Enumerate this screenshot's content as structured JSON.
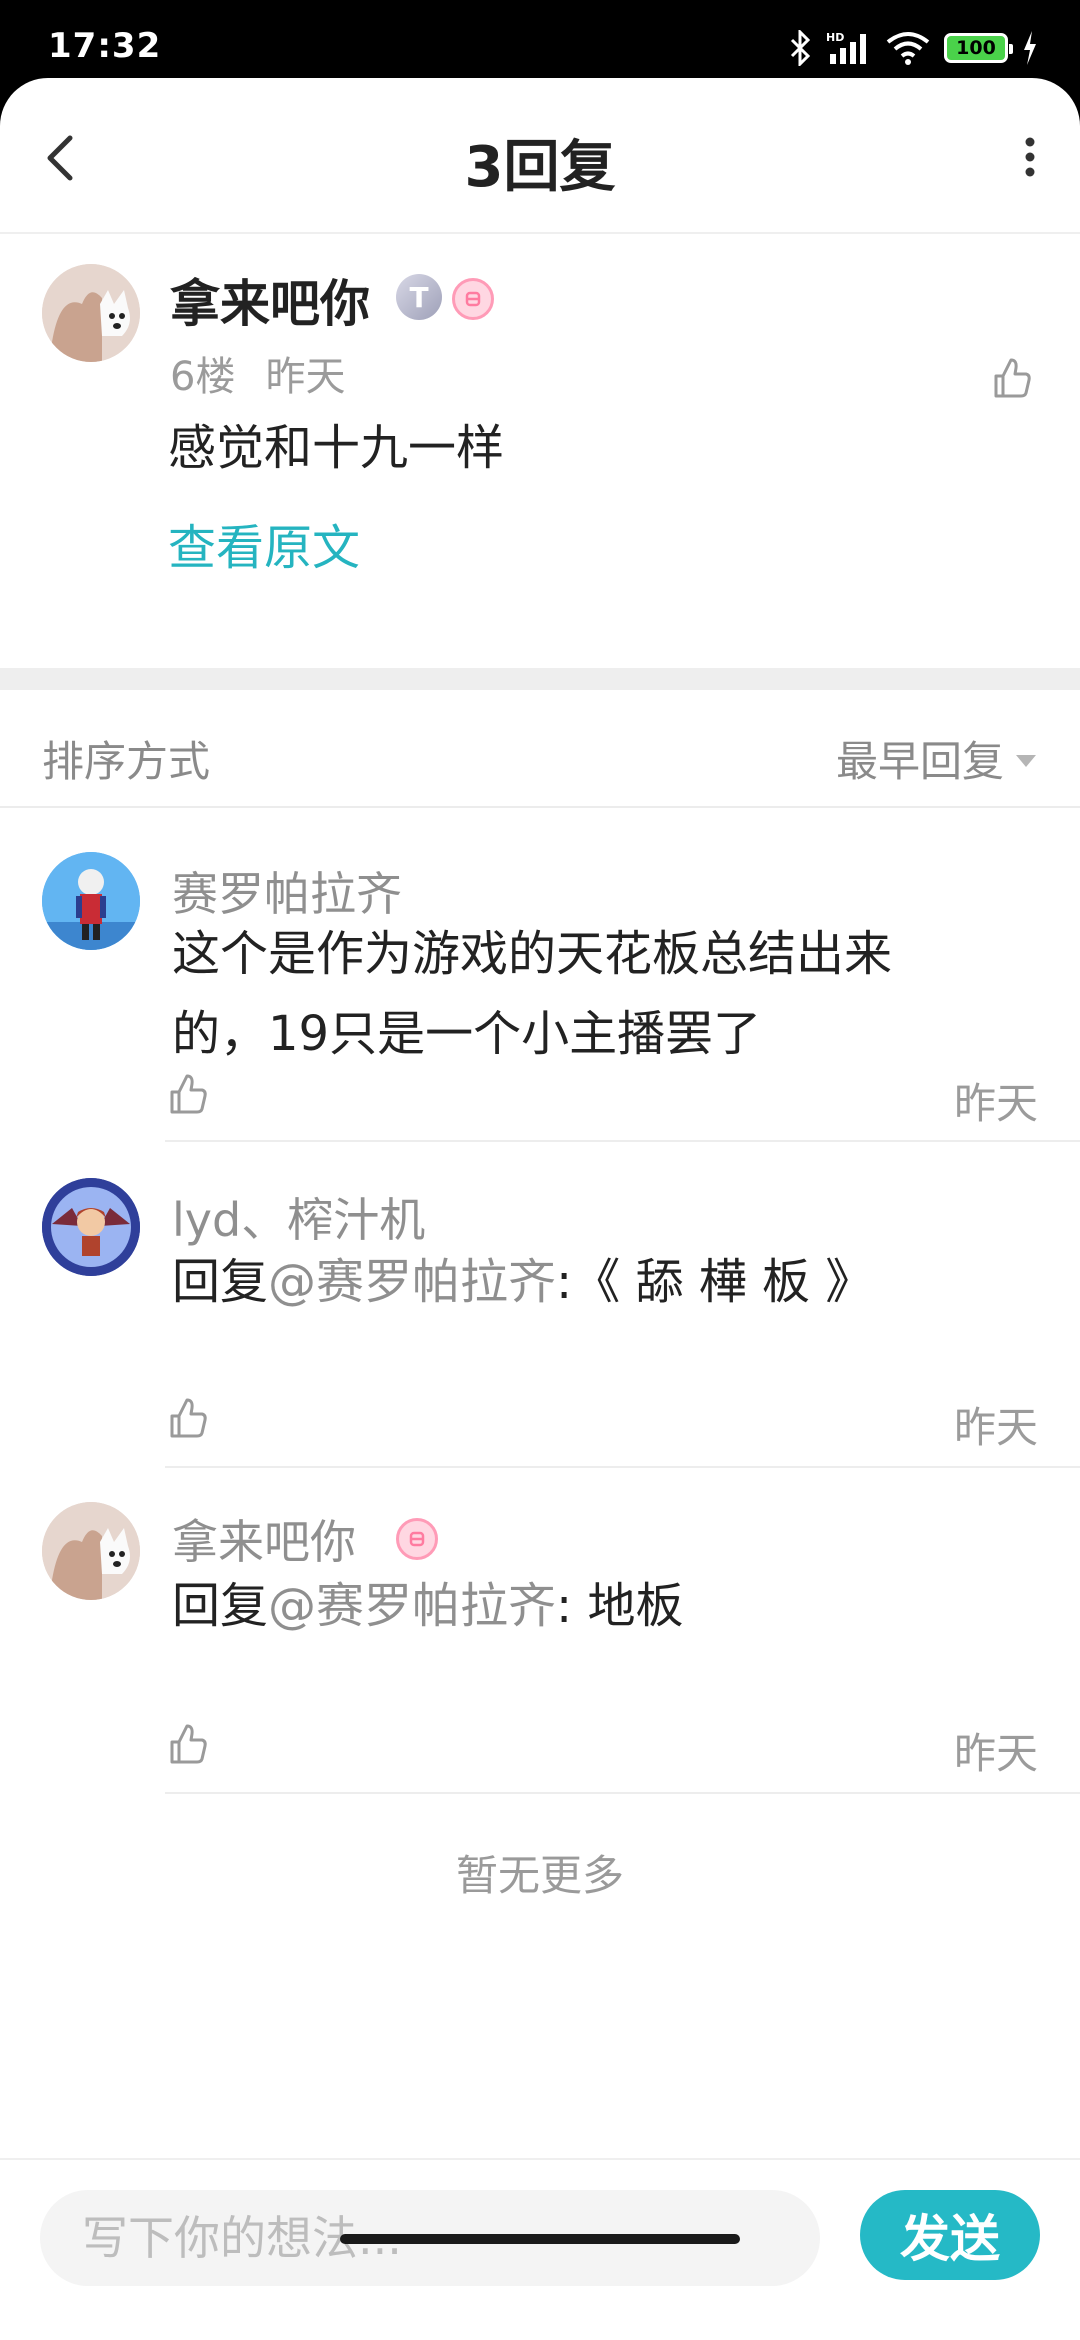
{
  "status_bar": {
    "time": "17:32",
    "battery": "100",
    "icons": [
      "bluetooth-icon",
      "signal-icon",
      "wifi-icon",
      "battery-icon",
      "charging-icon"
    ]
  },
  "header": {
    "title": "3回复",
    "back_icon": "chevron-left-icon",
    "more_icon": "more-vertical-icon"
  },
  "main_post": {
    "author": "拿来吧你",
    "badge_t": "T",
    "floor": "6楼",
    "time": "昨天",
    "content": "感觉和十九一样",
    "view_original": "查看原文"
  },
  "sort": {
    "label": "排序方式",
    "selected": "最早回复"
  },
  "replies": [
    {
      "author": "赛罗帕拉齐",
      "line1": "这个是作为游戏的天花板总结出来",
      "line2": "的，19只是一个小主播罢了",
      "time": "昨天"
    },
    {
      "author": "lyd、榨汁机",
      "prefix": "回复",
      "mention": "@赛罗帕拉齐",
      "content": ":《 舔 樺 板 》",
      "time": "昨天"
    },
    {
      "author": "拿来吧你",
      "prefix": "回复",
      "mention": "@赛罗帕拉齐",
      "content": ": 地板",
      "time": "昨天"
    }
  ],
  "no_more": "暂无更多",
  "composer": {
    "placeholder": "写下你的想法...",
    "send_label": "发送"
  },
  "colors": {
    "accent": "#25b9c6",
    "link": "#25b4c0",
    "muted_text": "#9b9b9b"
  }
}
